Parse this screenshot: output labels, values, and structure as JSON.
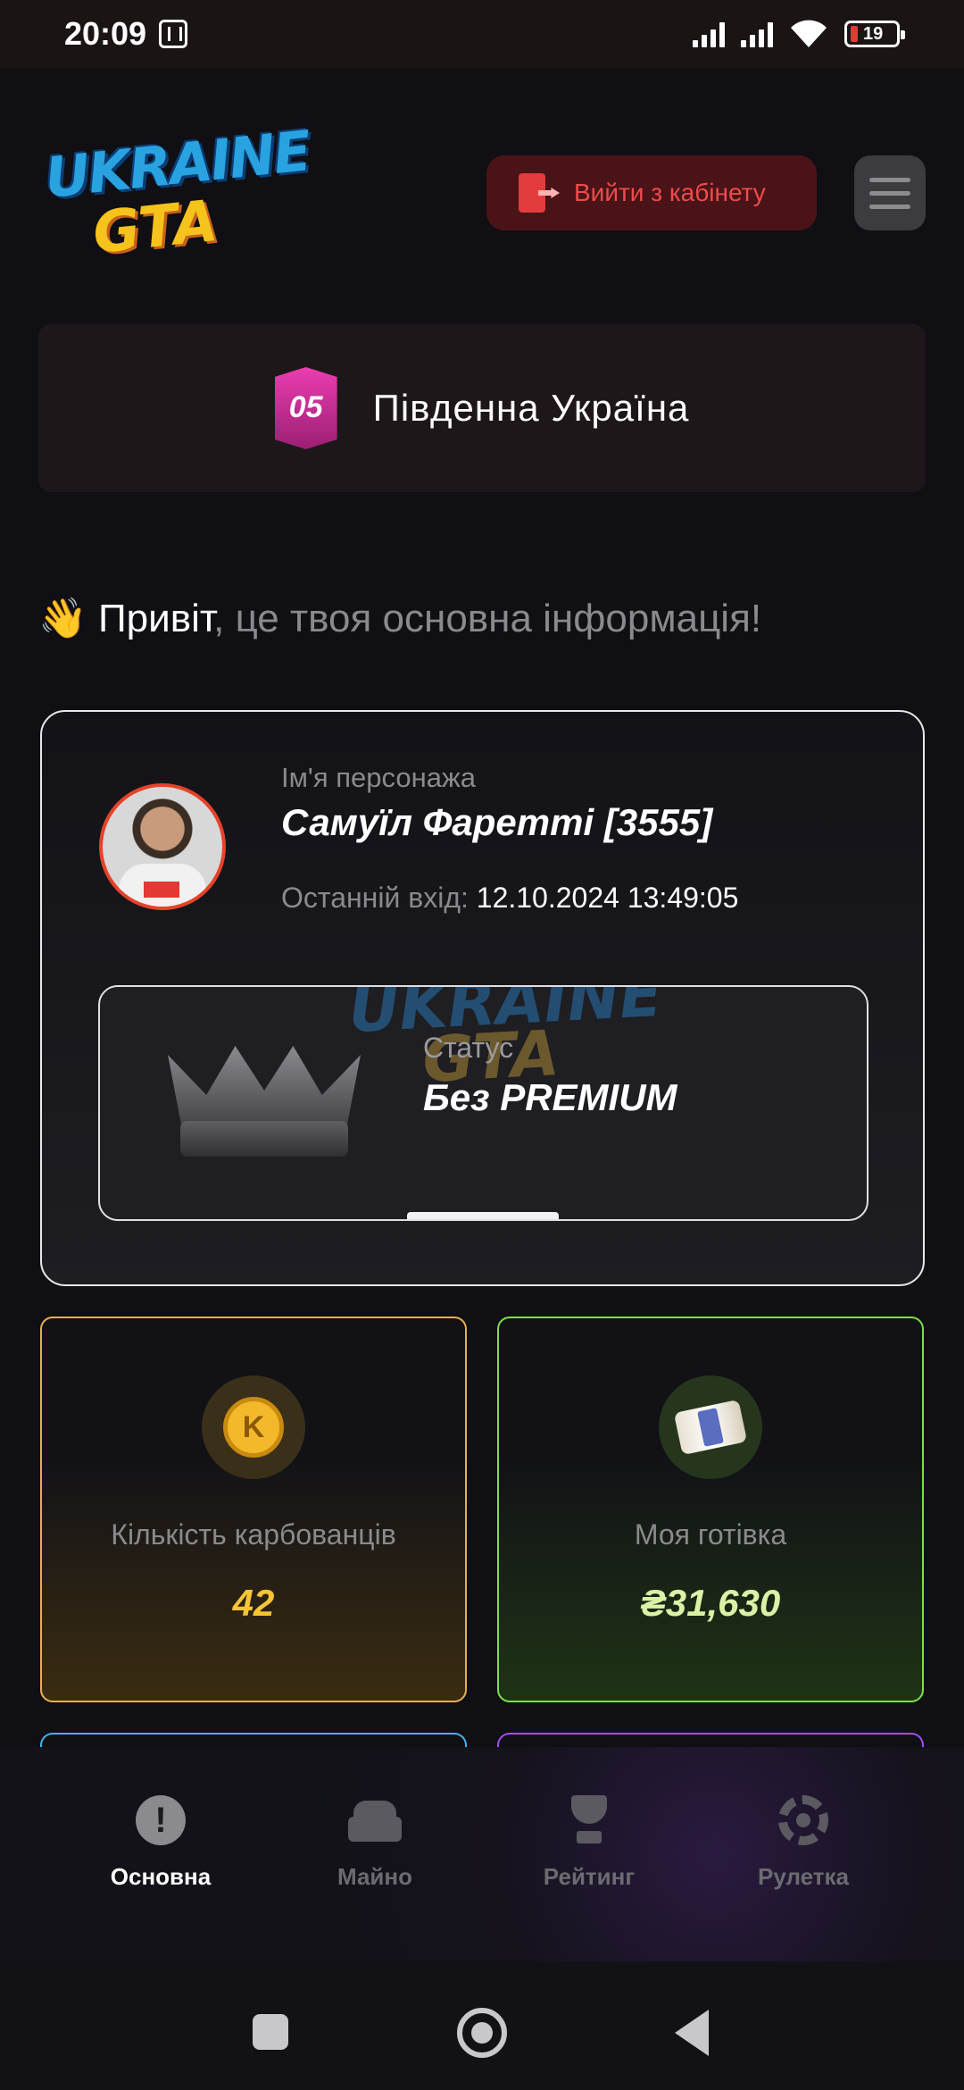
{
  "status_bar": {
    "time": "20:09",
    "battery": "19"
  },
  "header": {
    "logo_line1": "UKRAINE",
    "logo_line2": "GTA",
    "logout_label": "Вийти з кабінету"
  },
  "server": {
    "number": "05",
    "name": "Південна Україна"
  },
  "greeting": {
    "wave": "👋",
    "hi": "Привіт",
    "rest": ", це твоя основна інформація!"
  },
  "profile": {
    "name_label": "Ім'я персонажа",
    "name": "Самуїл Фаретті [3555]",
    "last_login_label": "Останній вхід:",
    "last_login_value": "12.10.2024 13:49:05",
    "status_label": "Статус",
    "status_value": "Без PREMIUM"
  },
  "stats": {
    "coins": {
      "label": "Кількість карбованців",
      "value": "42",
      "icon": "coin-icon"
    },
    "cash": {
      "label": "Моя готівка",
      "value": "₴31,630",
      "icon": "money-icon"
    }
  },
  "bottom_nav": [
    {
      "label": "Основна",
      "icon": "exclamation-icon",
      "active": true
    },
    {
      "label": "Майно",
      "icon": "car-icon",
      "active": false
    },
    {
      "label": "Рейтинг",
      "icon": "trophy-icon",
      "active": false
    },
    {
      "label": "Рулетка",
      "icon": "wheel-icon",
      "active": false
    }
  ],
  "colors": {
    "accent_red": "#ef4b4b",
    "coins_border": "#e8b04a",
    "cash_border": "#7ee04a",
    "coins_value": "#f6c435",
    "cash_value": "#d9f2a6"
  }
}
